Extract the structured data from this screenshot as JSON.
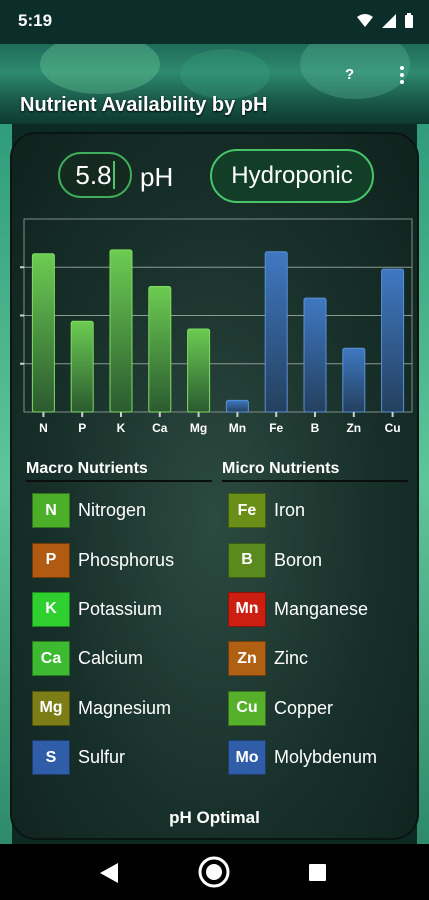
{
  "status": {
    "time": "5:19"
  },
  "header": {
    "title": "Nutrient Availability by pH",
    "help_label": "?"
  },
  "controls": {
    "ph_value": "5.8",
    "ph_unit": "pH",
    "mode_label": "Hydroponic"
  },
  "colors": {
    "macro_bar": "#5cb84a",
    "micro_bar": "#3a6eb0",
    "accent": "#3fae5a"
  },
  "chart_data": {
    "type": "bar",
    "categories": [
      "N",
      "P",
      "K",
      "Ca",
      "Mg",
      "Mn",
      "Fe",
      "B",
      "Zn",
      "Cu"
    ],
    "values": [
      0.82,
      0.47,
      0.84,
      0.65,
      0.43,
      0.06,
      0.83,
      0.59,
      0.33,
      0.74
    ],
    "groups": [
      "macro",
      "macro",
      "macro",
      "macro",
      "macro",
      "micro",
      "micro",
      "micro",
      "micro",
      "micro"
    ],
    "ylim": [
      0,
      1
    ],
    "grid": true
  },
  "macro": {
    "heading": "Macro Nutrients",
    "items": [
      {
        "symbol": "N",
        "name": "Nitrogen",
        "color": "#4caf2a"
      },
      {
        "symbol": "P",
        "name": "Phosphorus",
        "color": "#b05a12"
      },
      {
        "symbol": "K",
        "name": "Potassium",
        "color": "#2fcf2f"
      },
      {
        "symbol": "Ca",
        "name": "Calcium",
        "color": "#3dba32"
      },
      {
        "symbol": "Mg",
        "name": "Magnesium",
        "color": "#7d7d18"
      },
      {
        "symbol": "S",
        "name": "Sulfur",
        "color": "#2f5da8"
      }
    ]
  },
  "micro": {
    "heading": "Micro Nutrients",
    "items": [
      {
        "symbol": "Fe",
        "name": "Iron",
        "color": "#6a8f18"
      },
      {
        "symbol": "B",
        "name": "Boron",
        "color": "#5a8a1e"
      },
      {
        "symbol": "Mn",
        "name": "Manganese",
        "color": "#cc1f12"
      },
      {
        "symbol": "Zn",
        "name": "Zinc",
        "color": "#b06012"
      },
      {
        "symbol": "Cu",
        "name": "Copper",
        "color": "#56b02a"
      },
      {
        "symbol": "Mo",
        "name": "Molybdenum",
        "color": "#2f5da8"
      }
    ]
  },
  "footer": {
    "label": "pH Optimal"
  }
}
